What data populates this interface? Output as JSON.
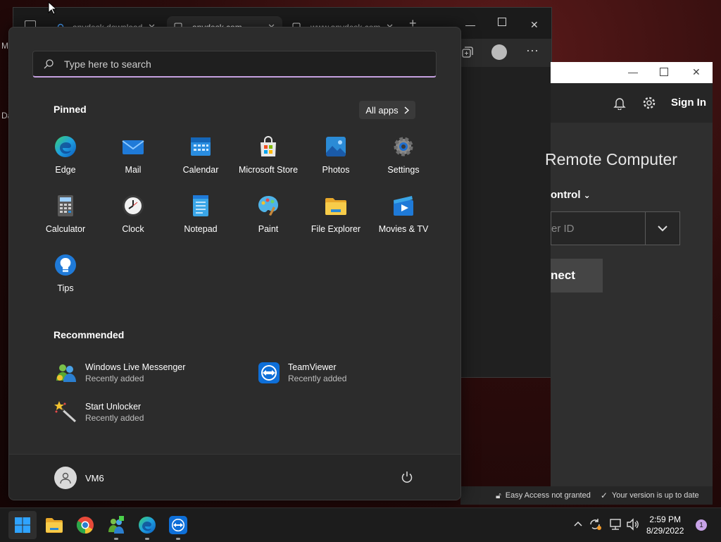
{
  "browser": {
    "tabs": [
      {
        "label": "anydesk download"
      },
      {
        "label": "anydesk.com"
      },
      {
        "label": "www.anydesk.com"
      }
    ],
    "new_tab_label": "+"
  },
  "anydesk": {
    "sign_in_label": "Sign In",
    "title_partial": "Remote Computer",
    "control_partial": "ontrol",
    "input_placeholder_partial": "er ID",
    "connect_partial": "nect",
    "status_access": "Easy Access not granted",
    "status_version": "Your version is up to date"
  },
  "left_slivers": {
    "top": "M",
    "bottom": "Da"
  },
  "start_menu": {
    "search_placeholder": "Type here to search",
    "pinned_title": "Pinned",
    "all_apps_label": "All apps",
    "pinned_apps": [
      {
        "label": "Edge",
        "icon": "edge-icon"
      },
      {
        "label": "Mail",
        "icon": "mail-icon"
      },
      {
        "label": "Calendar",
        "icon": "calendar-icon"
      },
      {
        "label": "Microsoft Store",
        "icon": "store-icon"
      },
      {
        "label": "Photos",
        "icon": "photos-icon"
      },
      {
        "label": "Settings",
        "icon": "gear-icon"
      },
      {
        "label": "Calculator",
        "icon": "calculator-icon"
      },
      {
        "label": "Clock",
        "icon": "clock-icon"
      },
      {
        "label": "Notepad",
        "icon": "notepad-icon"
      },
      {
        "label": "Paint",
        "icon": "paint-icon"
      },
      {
        "label": "File Explorer",
        "icon": "folder-icon"
      },
      {
        "label": "Movies & TV",
        "icon": "movies-icon"
      },
      {
        "label": "Tips",
        "icon": "tips-icon"
      }
    ],
    "recommended_title": "Recommended",
    "recommended": [
      {
        "title": "Windows Live Messenger",
        "subtitle": "Recently added",
        "icon": "messenger-icon"
      },
      {
        "title": "TeamViewer",
        "subtitle": "Recently added",
        "icon": "teamviewer-icon"
      },
      {
        "title": "Start Unlocker",
        "subtitle": "Recently added",
        "icon": "magic-wand-icon"
      }
    ],
    "user_name": "VM6"
  },
  "taskbar": {
    "time": "2:59 PM",
    "date": "8/29/2022",
    "notification_count": "1"
  },
  "colors": {
    "accent": "#c5a0e0",
    "start_bg": "#2c2c2c",
    "taskbar_bg": "#1c1c1c"
  }
}
